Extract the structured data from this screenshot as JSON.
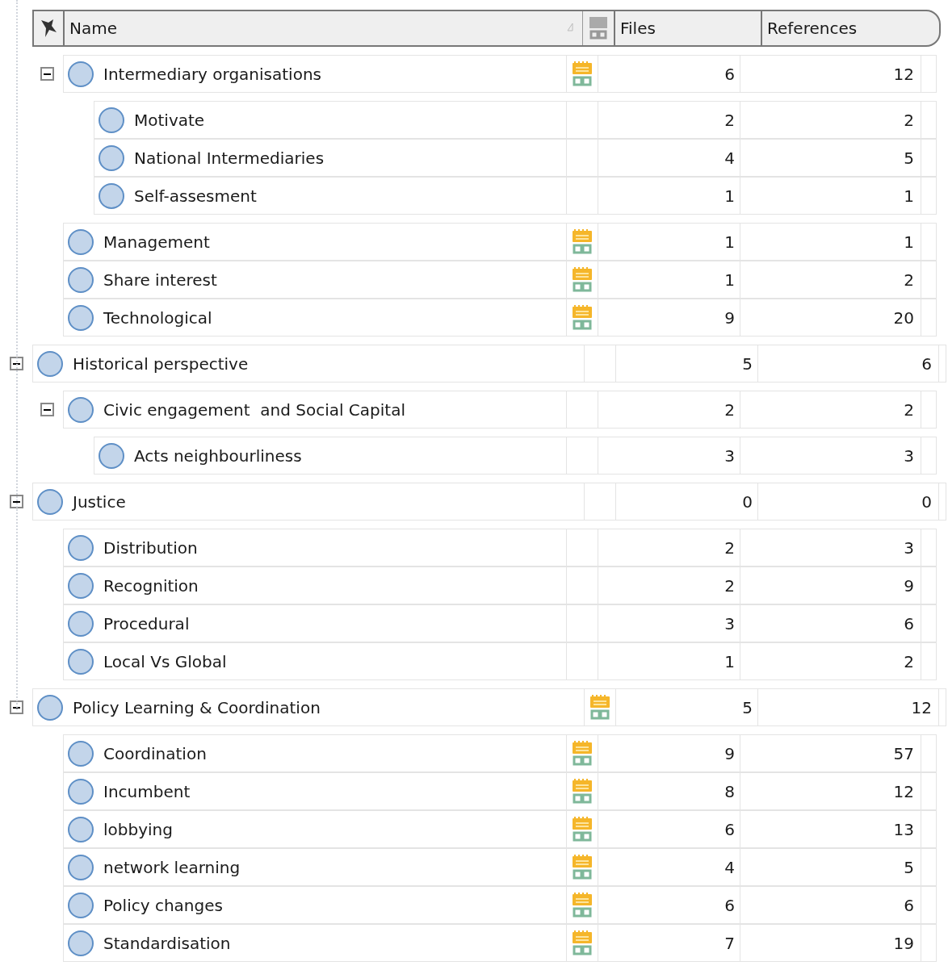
{
  "columns": {
    "name": "Name",
    "files": "Files",
    "references": "References"
  },
  "tree": {
    "children_of_parent_above": [
      {
        "name": "Intermediary organisations",
        "memo": true,
        "files": "6",
        "references": "12",
        "expanded": true,
        "children": [
          {
            "name": "Motivate",
            "memo": false,
            "files": "2",
            "references": "2"
          },
          {
            "name": "National Intermediaries",
            "memo": false,
            "files": "4",
            "references": "5"
          },
          {
            "name": "Self-assesment",
            "memo": false,
            "files": "1",
            "references": "1"
          }
        ]
      },
      {
        "name": "Management",
        "memo": true,
        "files": "1",
        "references": "1"
      },
      {
        "name": "Share interest",
        "memo": true,
        "files": "1",
        "references": "2"
      },
      {
        "name": "Technological",
        "memo": true,
        "files": "9",
        "references": "20"
      }
    ],
    "nodes": [
      {
        "name": "Historical perspective",
        "memo": false,
        "files": "5",
        "references": "6",
        "expanded": true,
        "children": [
          {
            "name": "Civic engagement  and Social Capital",
            "memo": false,
            "files": "2",
            "references": "2",
            "expanded": true,
            "children": [
              {
                "name": "Acts neighbourliness",
                "memo": false,
                "files": "3",
                "references": "3"
              }
            ]
          }
        ]
      },
      {
        "name": "Justice",
        "memo": false,
        "files": "0",
        "references": "0",
        "expanded": true,
        "children": [
          {
            "name": "Distribution",
            "memo": false,
            "files": "2",
            "references": "3"
          },
          {
            "name": "Recognition",
            "memo": false,
            "files": "2",
            "references": "9"
          },
          {
            "name": "Procedural",
            "memo": false,
            "files": "3",
            "references": "6"
          },
          {
            "name": "Local Vs Global",
            "memo": false,
            "files": "1",
            "references": "2"
          }
        ]
      },
      {
        "name": "Policy Learning & Coordination",
        "memo": true,
        "files": "5",
        "references": "12",
        "expanded": true,
        "children": [
          {
            "name": "Coordination",
            "memo": true,
            "files": "9",
            "references": "57"
          },
          {
            "name": "Incumbent",
            "memo": true,
            "files": "8",
            "references": "12"
          },
          {
            "name": "lobbying",
            "memo": true,
            "files": "6",
            "references": "13"
          },
          {
            "name": "network learning",
            "memo": true,
            "files": "4",
            "references": "5"
          },
          {
            "name": "Policy changes",
            "memo": true,
            "files": "6",
            "references": "6"
          },
          {
            "name": "Standardisation",
            "memo": true,
            "files": "7",
            "references": "19"
          }
        ]
      }
    ]
  }
}
